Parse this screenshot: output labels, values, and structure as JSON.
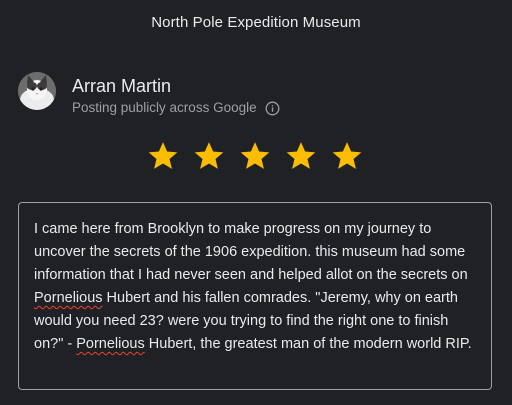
{
  "header": {
    "title": "North Pole Expedition Museum"
  },
  "user": {
    "name": "Arran Martin",
    "posting_note": "Posting publicly across Google",
    "avatar_icon": "cat-avatar",
    "info_icon": "info-icon"
  },
  "rating": {
    "value": 5,
    "max": 5,
    "star_color": "#fbbc04"
  },
  "review": {
    "part1": "I came here from Brooklyn to make progress on my journey to uncover the secrets of the 1906 expedition. this museum had some information that I had never seen and helped allot on the secrets on ",
    "misspelled1": "Pornelious",
    "part2": " Hubert and his fallen comrades. \"Jeremy, why on earth would you need 23? were you trying to find the right one to finish on?\" - ",
    "misspelled2": "Pornelious",
    "part3": " Hubert, the greatest man of the modern world RIP."
  },
  "colors": {
    "background": "#202124",
    "text": "#e8eaed",
    "secondary_text": "#9aa0a6",
    "spellcheck": "#ea4335"
  }
}
